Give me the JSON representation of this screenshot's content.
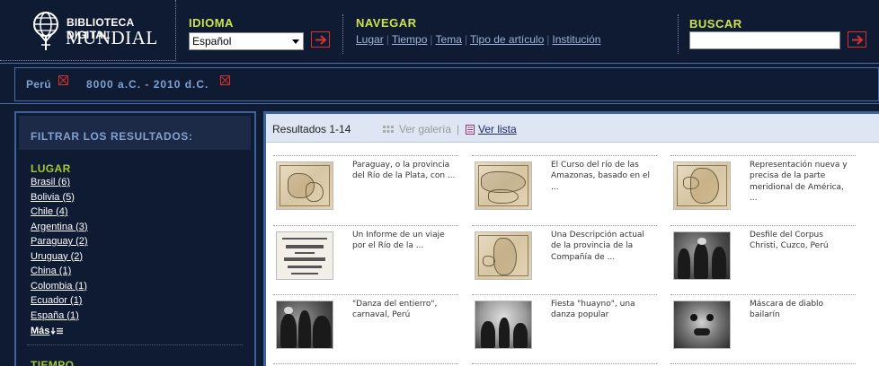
{
  "logo": {
    "line1": "BIBLIOTECA DIGITAL",
    "line2": "MUNDIAL"
  },
  "idioma": {
    "title": "IDIOMA",
    "selected": "Español"
  },
  "navegar": {
    "title": "NAVEGAR",
    "links": [
      "Lugar",
      "Tiempo",
      "Tema",
      "Tipo de artículo",
      "Institución"
    ]
  },
  "buscar": {
    "title": "BUSCAR",
    "value": ""
  },
  "filters": {
    "place": "Perú",
    "date": "8000 a.C. - 2010 d.C."
  },
  "sidebar": {
    "title": "FILTRAR LOS RESULTADOS:",
    "lugar": {
      "title": "LUGAR",
      "items": [
        "Brasil (6)",
        "Bolivia (5)",
        "Chile (4)",
        "Argentina (3)",
        "Paraguay (2)",
        "Uruguay (2)",
        "China (1)",
        "Colombia (1)",
        "Ecuador (1)",
        "España (1)"
      ],
      "more": "Más"
    },
    "tiempo": {
      "title": "TIEMPO"
    }
  },
  "results": {
    "count": "Resultados 1-14",
    "ver_galeria": "Ver galería",
    "separator": "|",
    "ver_lista": "Ver lista",
    "items": [
      {
        "caption": "Paraguay, o la provincia del Río de la Plata, con ...",
        "kind": "map"
      },
      {
        "caption": "El Curso del río de las Amazonas, basado en el ...",
        "kind": "map"
      },
      {
        "caption": "Representación nueva y precisa de la parte meridional de América, ...",
        "kind": "map"
      },
      {
        "caption": "Un Informe de un viaje por el Río de la ...",
        "kind": "book"
      },
      {
        "caption": "Una Descripción actual de la provincia de la Compañía de ...",
        "kind": "map"
      },
      {
        "caption": "Desfile del Corpus Christi, Cuzco, Perú",
        "kind": "photo"
      },
      {
        "caption": "\"Danza del entierro\", carnaval, Perú",
        "kind": "photo"
      },
      {
        "caption": "Fiesta \"huayno\", una danza popular",
        "kind": "photo"
      },
      {
        "caption": "Máscara de diablo bailarín",
        "kind": "photo"
      }
    ]
  },
  "colors": {
    "background": "#0f1a33",
    "accent_green": "#cfe44a",
    "accent_red": "#d9322a",
    "panel_blue": "#3d6499",
    "link_blue": "#9fb4d6"
  }
}
